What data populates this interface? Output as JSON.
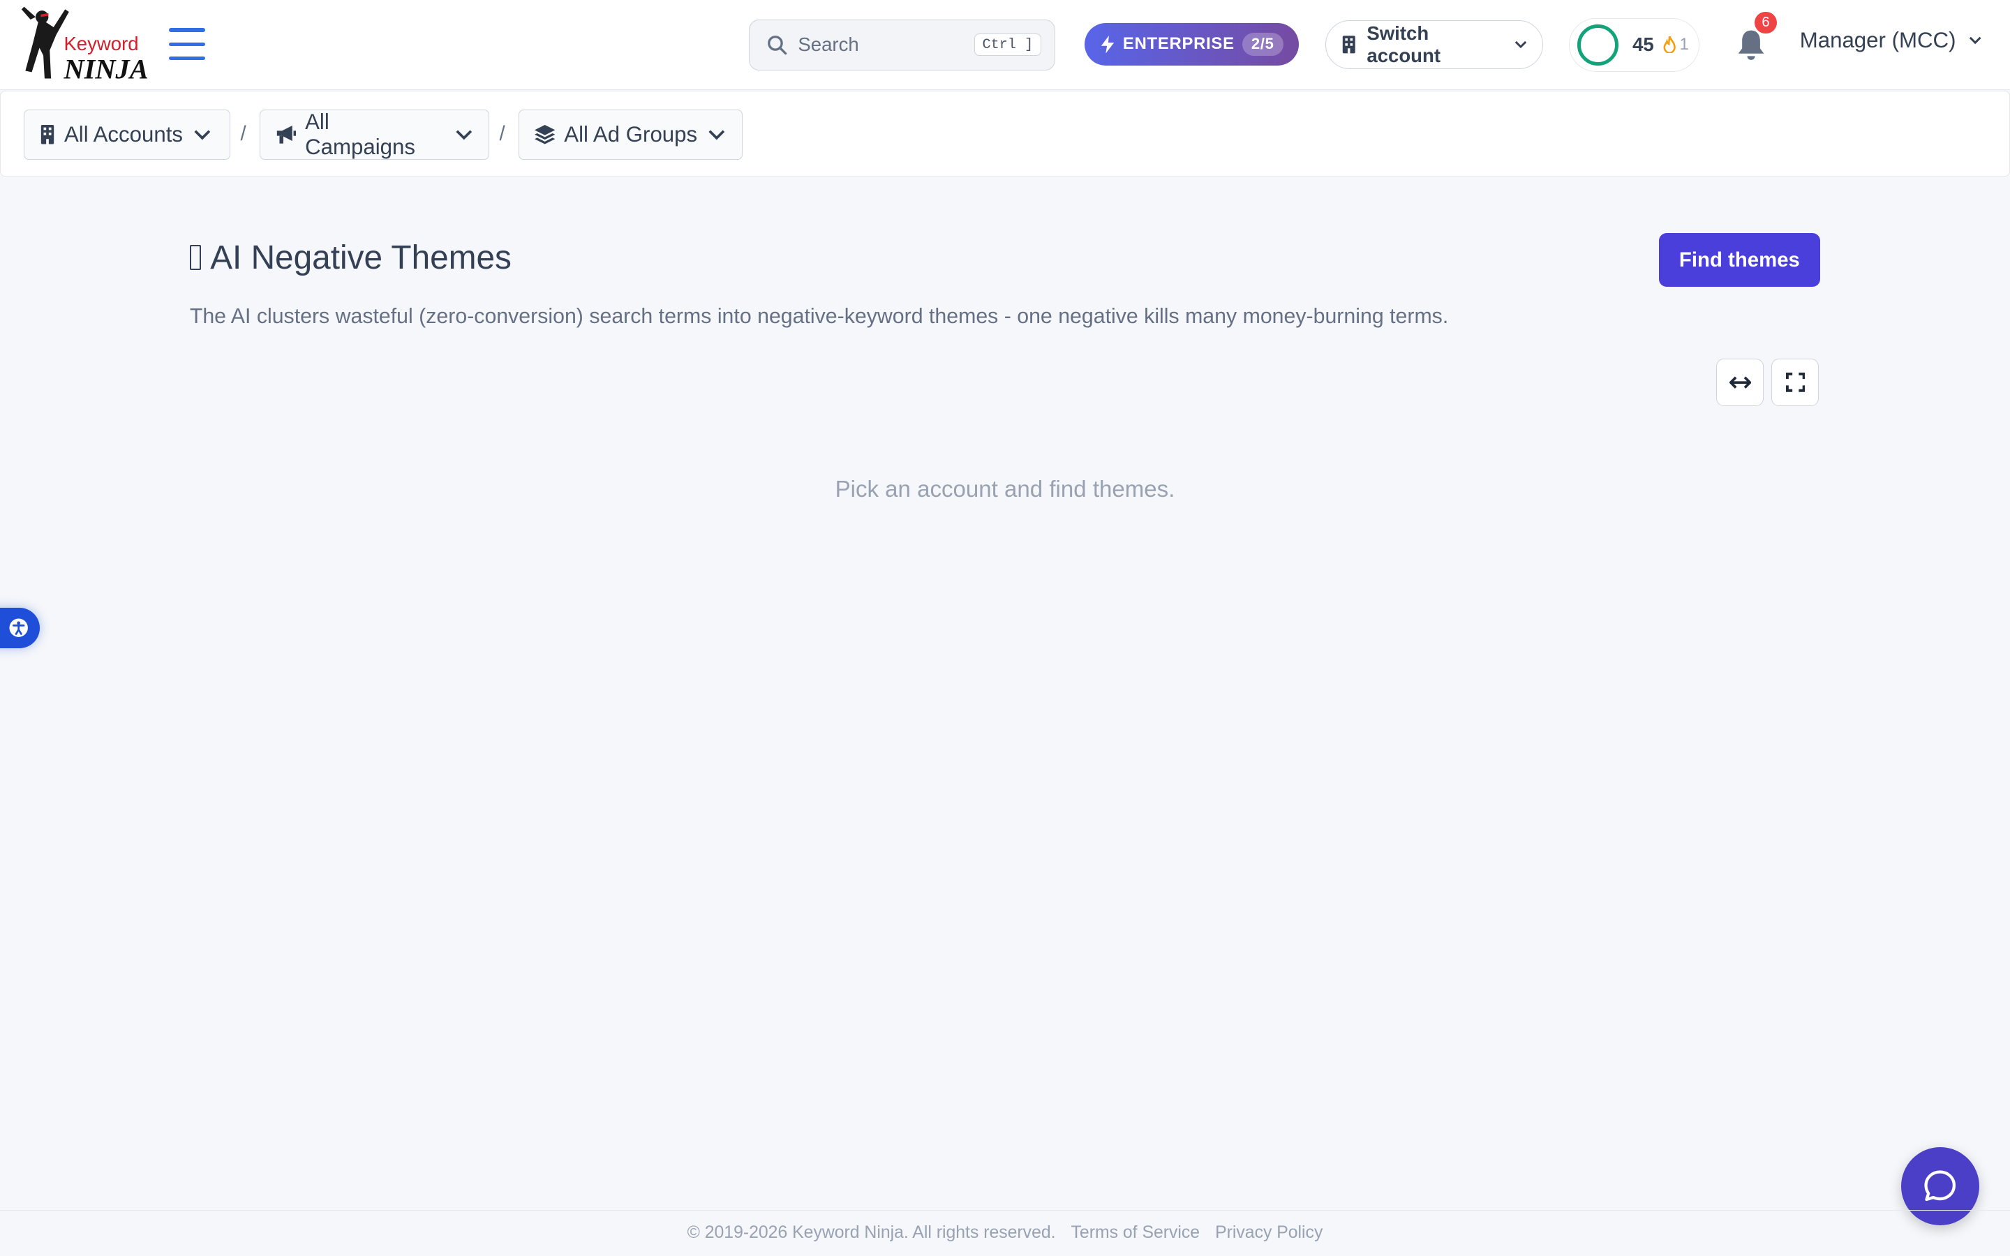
{
  "brand": {
    "logo_top": "Keyword",
    "logo_bottom": "NINJA"
  },
  "header": {
    "search_placeholder": "Search",
    "search_shortcut": "Ctrl ]",
    "plan_label": "ENTERPRISE",
    "plan_usage": "2/5",
    "switch_account_label": "Switch account",
    "score": "45",
    "streak": "1",
    "notifications_count": "6",
    "account_menu_label": "Manager (MCC)"
  },
  "filters": {
    "accounts": "All Accounts",
    "campaigns": "All Campaigns",
    "ad_groups": "All Ad Groups",
    "separator": "/"
  },
  "main": {
    "title": "AI Negative Themes",
    "find_button": "Find themes",
    "description": "The AI clusters wasteful (zero-conversion) search terms into negative-keyword themes - one negative kills many money-burning terms.",
    "empty_state": "Pick an account and find themes."
  },
  "footer": {
    "copyright": "© 2019-2026 Keyword Ninja. All rights reserved.",
    "terms": "Terms of Service",
    "privacy": "Privacy Policy"
  },
  "colors": {
    "primary": "#4b3fdb",
    "accent_blue": "#2f6fe4",
    "score_ring": "#12a37a",
    "badge": "#ef4444"
  }
}
